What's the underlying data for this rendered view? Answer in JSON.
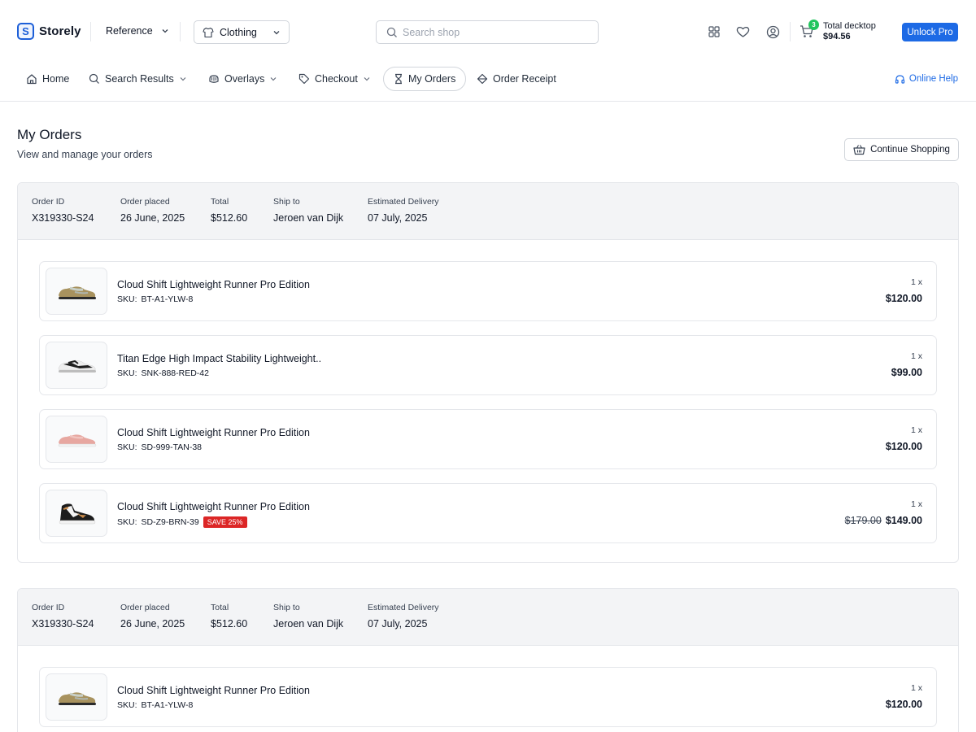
{
  "brand": {
    "mark": "S",
    "name": "Storely"
  },
  "header": {
    "reference_label": "Reference",
    "category_label": "Clothing",
    "search_placeholder": "Search shop",
    "cart_count": "3",
    "cart_total_label": "Total decktop",
    "cart_total_amount": "$94.56",
    "unlock_label": "Unlock Pro"
  },
  "nav": {
    "items": [
      {
        "label": "Home",
        "icon": "home-icon"
      },
      {
        "label": "Search Results",
        "icon": "search-icon",
        "dropdown": true
      },
      {
        "label": "Overlays",
        "icon": "layers-icon",
        "dropdown": true
      },
      {
        "label": "Checkout",
        "icon": "tag-icon",
        "dropdown": true
      },
      {
        "label": "My Orders",
        "icon": "hourglass-icon",
        "active": true
      },
      {
        "label": "Order Receipt",
        "icon": "receipt-icon"
      }
    ],
    "help_label": "Online Help"
  },
  "page": {
    "title": "My Orders",
    "subtitle": "View and manage your orders",
    "continue_label": "Continue Shopping"
  },
  "labels": {
    "order_id": "Order ID",
    "order_placed": "Order placed",
    "total": "Total",
    "ship_to": "Ship to",
    "estimated_delivery": "Estimated Delivery",
    "sku": "SKU:"
  },
  "orders": [
    {
      "order_id": "X319330-S24",
      "placed": "26 June, 2025",
      "total": "$512.60",
      "ship_to": "Jeroen van Dijk",
      "delivery": "07 July, 2025",
      "items": [
        {
          "name": "Cloud Shift Lightweight Runner Pro Edition",
          "sku": "BT-A1-YLW-8",
          "qty": "1 x",
          "price": "$120.00",
          "shoe": "tan"
        },
        {
          "name": "Titan Edge High Impact Stability Lightweight..",
          "sku": "SNK-888-RED-42",
          "qty": "1 x",
          "price": "$99.00",
          "shoe": "black-white"
        },
        {
          "name": "Cloud Shift Lightweight Runner Pro Edition",
          "sku": "SD-999-TAN-38",
          "qty": "1 x",
          "price": "$120.00",
          "shoe": "pink"
        },
        {
          "name": "Cloud Shift Lightweight Runner Pro Edition",
          "sku": "SD-Z9-BRN-39",
          "qty": "1 x",
          "old_price": "$179.00",
          "price": "$149.00",
          "badge": "SAVE 25%",
          "shoe": "high-top"
        }
      ]
    },
    {
      "order_id": "X319330-S24",
      "placed": "26 June, 2025",
      "total": "$512.60",
      "ship_to": "Jeroen van Dijk",
      "delivery": "07 July, 2025",
      "items": [
        {
          "name": "Cloud Shift Lightweight Runner Pro Edition",
          "sku": "BT-A1-YLW-8",
          "qty": "1 x",
          "price": "$120.00",
          "shoe": "tan"
        }
      ]
    }
  ],
  "colors": {
    "accent": "#1d6ae5",
    "badge_green": "#22c55e",
    "sale_red": "#dc2626",
    "header_bg": "#f3f4f6"
  }
}
